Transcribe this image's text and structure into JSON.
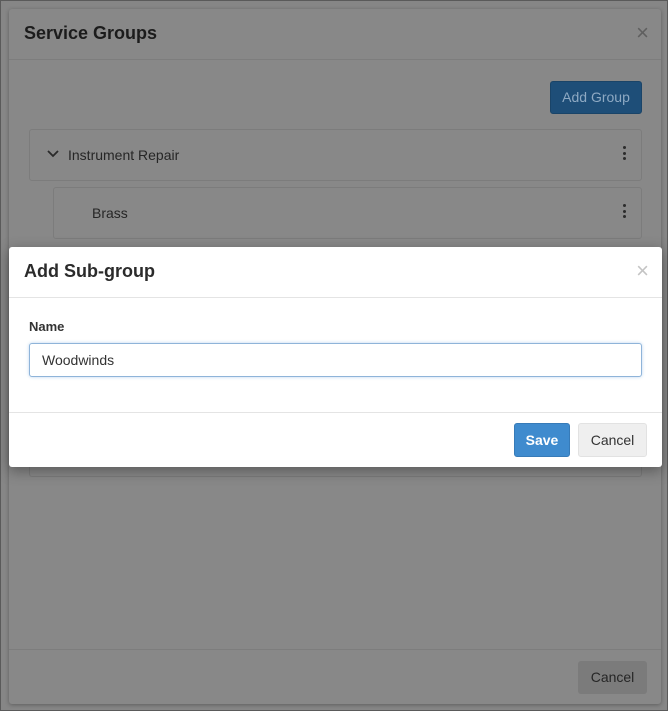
{
  "outer_modal": {
    "title": "Service Groups",
    "close_glyph": "×",
    "add_group_label": "Add Group",
    "groups": [
      {
        "label": "Instrument Repair",
        "expand_icon": "chevron-down-icon",
        "menu_icon": "kebab-menu-icon",
        "subgroups": [
          {
            "label": "Brass",
            "menu_icon": "kebab-menu-icon"
          }
        ]
      }
    ],
    "cancel_label": "Cancel"
  },
  "inner_modal": {
    "title": "Add Sub-group",
    "close_glyph": "×",
    "name_label": "Name",
    "name_value": "Woodwinds",
    "save_label": "Save",
    "cancel_label": "Cancel"
  },
  "colors": {
    "primary": "#3f8bce",
    "overlay": "#888888"
  }
}
